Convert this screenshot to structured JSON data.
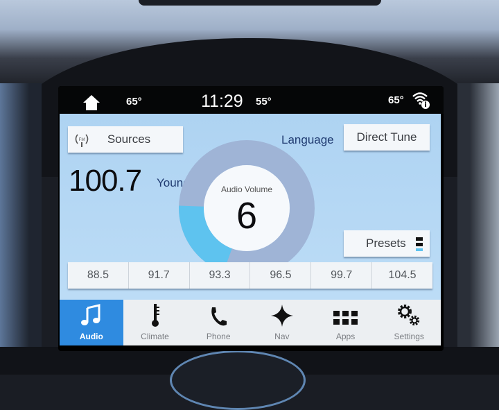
{
  "status_bar": {
    "home_icon": "home-icon",
    "cabin_temp_left": "65°",
    "clock": "11:29",
    "outside_temp": "55°",
    "cabin_temp_right": "65°",
    "wifi_icon": "wifi-info-icon"
  },
  "audio": {
    "sources_label": "Sources",
    "sources_icon": "fm-radio-icon",
    "language_label": "Language",
    "direct_tune_label": "Direct Tune",
    "frequency": "100.7",
    "station_name": "Young",
    "presets_label": "Presets",
    "presets_icon": "preset-pages-icon",
    "volume": {
      "label": "Audio Volume",
      "value": "6",
      "level_fraction": 0.2,
      "colors": {
        "track": "#9fb4d6",
        "fill": "#5ec3ef",
        "center": "#f6f9fc"
      }
    },
    "preset_stations": [
      "88.5",
      "91.7",
      "93.3",
      "96.5",
      "99.7",
      "104.5"
    ]
  },
  "nav": {
    "active_color": "#2f8be0",
    "items": [
      {
        "label": "Audio",
        "icon": "music-note-icon",
        "active": true
      },
      {
        "label": "Climate",
        "icon": "thermometer-icon",
        "active": false
      },
      {
        "label": "Phone",
        "icon": "phone-icon",
        "active": false
      },
      {
        "label": "Nav",
        "icon": "compass-star-icon",
        "active": false
      },
      {
        "label": "Apps",
        "icon": "apps-grid-icon",
        "active": false
      },
      {
        "label": "Settings",
        "icon": "gears-icon",
        "active": false
      }
    ]
  }
}
